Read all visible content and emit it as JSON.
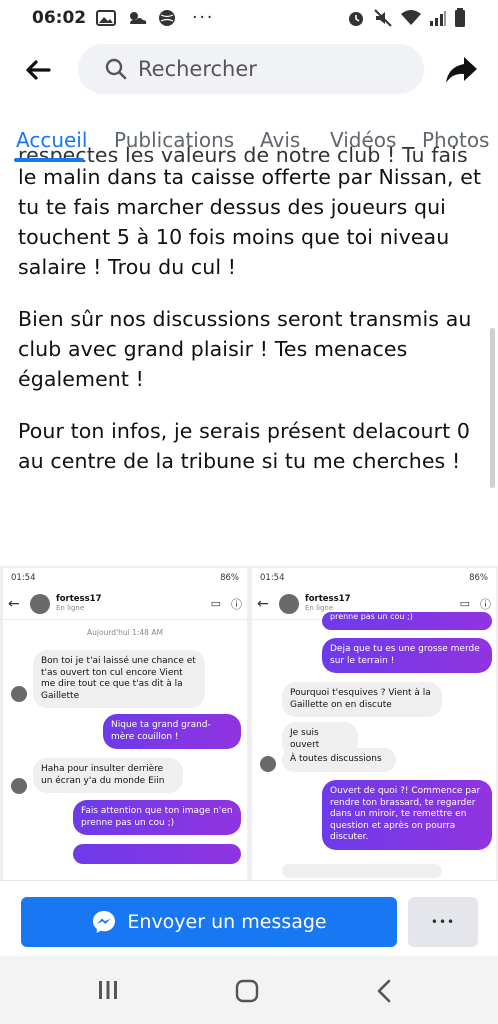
{
  "status_bar": {
    "time": "06:02",
    "extra": "···"
  },
  "search": {
    "placeholder": "Rechercher"
  },
  "tabs": [
    {
      "label": "Accueil",
      "active": true
    },
    {
      "label": "Publications"
    },
    {
      "label": "Avis"
    },
    {
      "label": "Vidéos"
    },
    {
      "label": "Photos"
    }
  ],
  "post": {
    "cut_line": "respectes les valeurs de notre club ! Tu fais",
    "paragraph1": "le malin dans ta caisse offerte par Nissan, et tu te fais marcher dessus des joueurs qui touchent 5 à 10 fois moins que toi niveau salaire ! Trou du cul !",
    "paragraph2": "Bien sûr nos discussions seront transmis au club avec grand plaisir ! Tes menaces également !",
    "paragraph3": "Pour ton infos, je serais présent delacourt 0 au centre de la tribune si tu me cherches !"
  },
  "screenshots": {
    "left": {
      "time": "01:54",
      "battery": "86%",
      "username": "fortess17",
      "sub": "En ligne",
      "date": "Aujourd'hui 1:48 AM",
      "messages": [
        "Bon toi je t'ai laissé une chance et t'as ouvert ton cul encore Vient me dire tout ce que t'as dit à la Gaillette",
        "Nique ta grand grand-mère couillon !",
        "Haha pour insulter derrière un écran y'a du monde Eiin",
        "Fais attention que ton image n'en prenne pas un cou ;)"
      ]
    },
    "right": {
      "time": "01:54",
      "battery": "86%",
      "username": "fortess17",
      "sub": "En ligne",
      "messages": [
        "prenne pas un cou ;)",
        "Deja que tu es une grosse merde sur le terrain !",
        "Pourquoi t'esquives ? Vient à la Gaillette on en discute",
        "Je suis ouvert",
        "À toutes discussions",
        "Ouvert de quoi ?! Commence par rendre ton brassard, te regarder dans un miroir, te remettre en question et après on pourra discuter."
      ]
    }
  },
  "actions": {
    "send_message": "Envoyer un message",
    "more": "•••"
  },
  "colors": {
    "accent": "#1877f2",
    "bubble_out": "#7a38e6"
  }
}
